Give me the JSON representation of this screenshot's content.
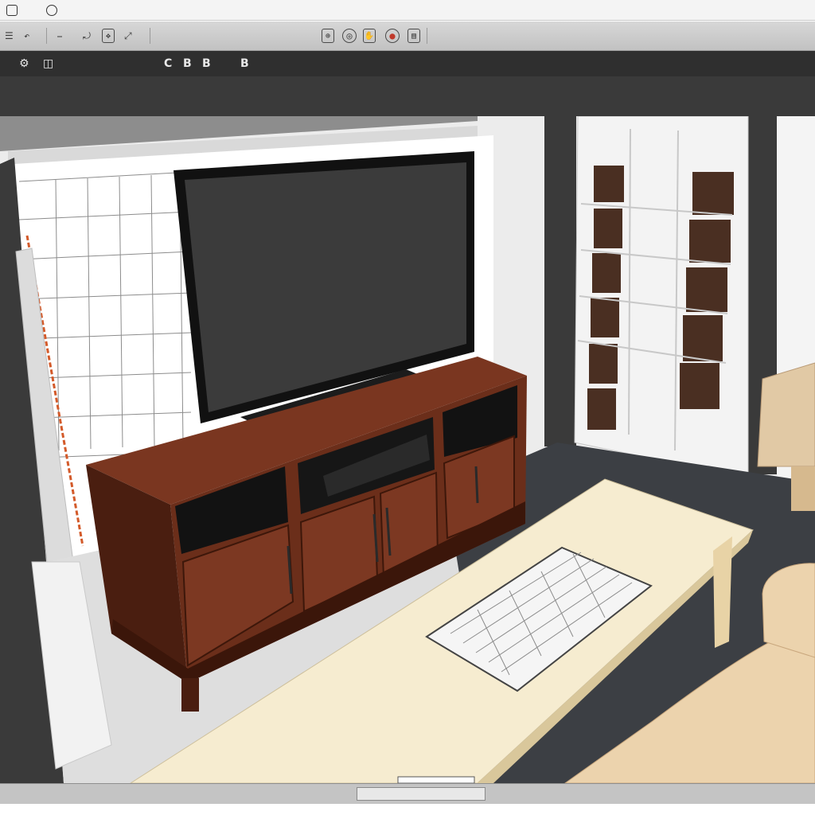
{
  "window": {
    "titlebar_icons": [
      "app-icon",
      "document-icon"
    ]
  },
  "toolbar1": {
    "tools": [
      {
        "name": "menu-icon",
        "glyph": "☰"
      },
      {
        "name": "undo-icon",
        "glyph": "↶"
      },
      {
        "name": "draw-line-icon",
        "glyph": "⎯"
      },
      {
        "name": "rotate-icon",
        "glyph": "⤾"
      },
      {
        "name": "move-icon",
        "glyph": "✥"
      },
      {
        "name": "scale-icon",
        "glyph": "⤢"
      },
      {
        "name": "orbit-icon",
        "glyph": "◎"
      },
      {
        "name": "pan-icon",
        "glyph": "✋"
      },
      {
        "name": "zoom-icon",
        "glyph": "⊕"
      },
      {
        "name": "record-icon",
        "glyph": "●"
      },
      {
        "name": "layers-icon",
        "glyph": "▤"
      }
    ]
  },
  "toolbar2": {
    "items": [
      {
        "name": "settings-icon",
        "label": "⚙"
      },
      {
        "name": "view-mode-icon",
        "label": "◫"
      },
      {
        "name": "c-button",
        "label": "C"
      },
      {
        "name": "b-button",
        "label": "B"
      },
      {
        "name": "b2-button",
        "label": "B"
      },
      {
        "name": "b3-button",
        "label": "B"
      }
    ]
  },
  "colors": {
    "wood": "#6b2e1a",
    "wood_dark": "#4a1e10",
    "tv": "#3b3b3b",
    "floor": "#dedede",
    "carpet": "#3c3f44",
    "table": "#f6ecd0",
    "sofa": "#ecd3ad",
    "door_panel": "#4a2f22"
  }
}
